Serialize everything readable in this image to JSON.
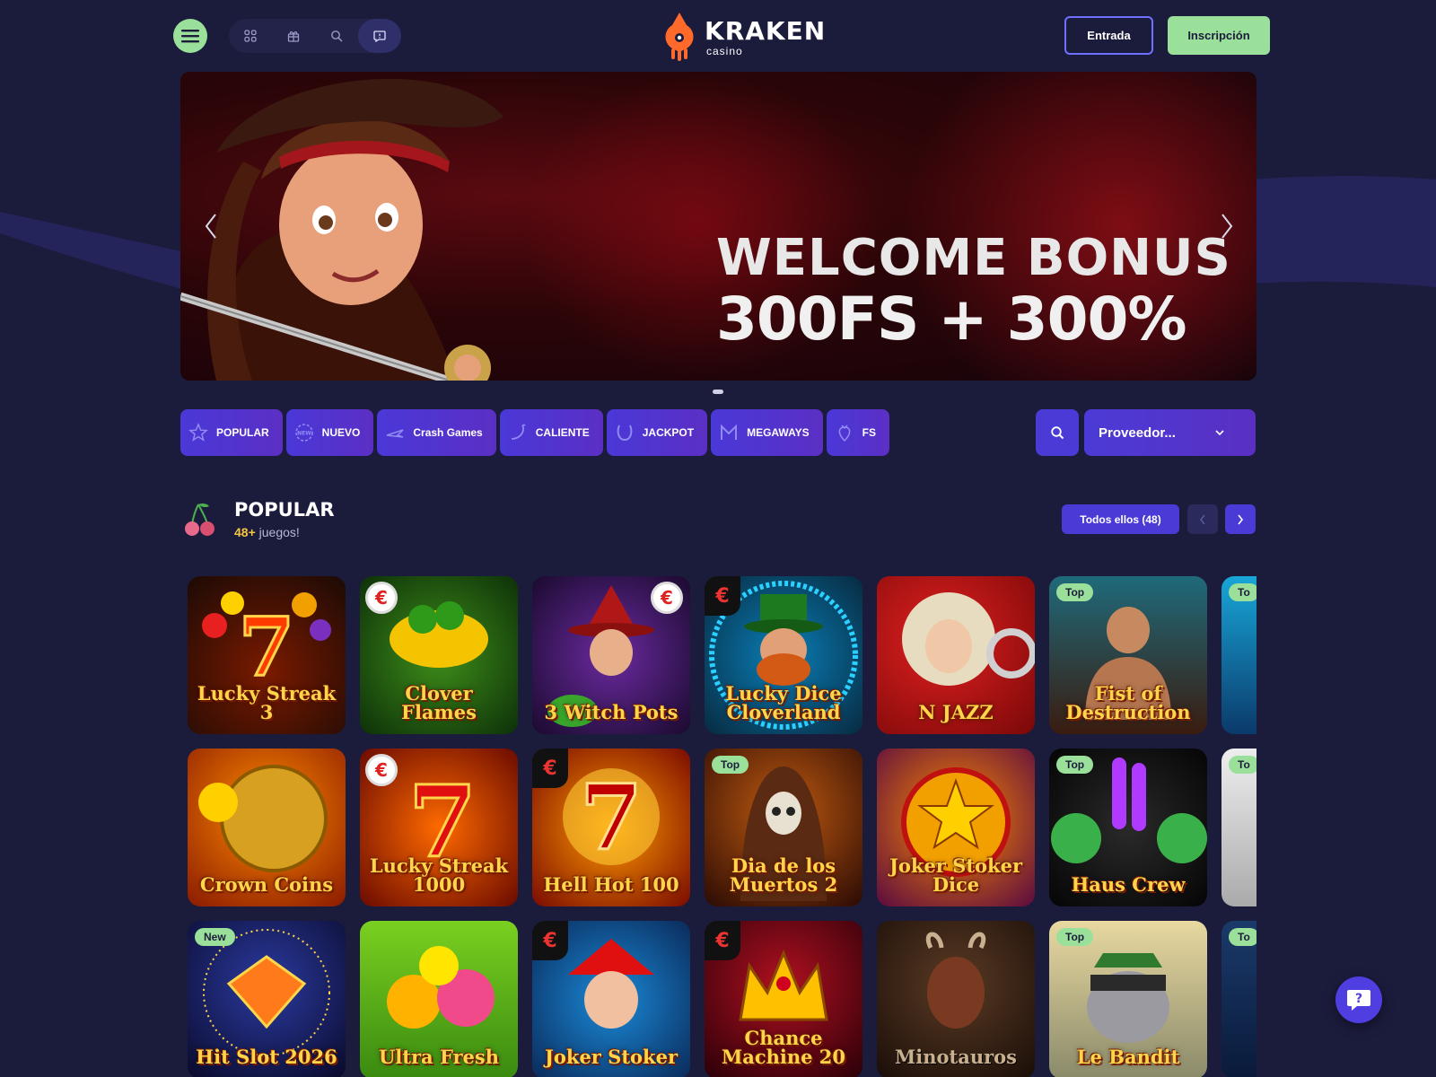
{
  "header": {
    "logo_text": "KRAKEN",
    "logo_sub": "casino",
    "login_label": "Entrada",
    "register_label": "Inscripción"
  },
  "banner": {
    "line1": "WELCOME BONUS",
    "line2": "300FS + 300%"
  },
  "categories": [
    {
      "label": "POPULAR",
      "icon": "star-icon"
    },
    {
      "label": "NUEVO",
      "icon": "new-icon"
    },
    {
      "label": "Crash Games",
      "icon": "plane-icon"
    },
    {
      "label": "CALIENTE",
      "icon": "chili-icon"
    },
    {
      "label": "JACKPOT",
      "icon": "horseshoe-icon"
    },
    {
      "label": "MEGAWAYS",
      "icon": "m-icon"
    },
    {
      "label": "FS",
      "icon": "strawberry-icon"
    }
  ],
  "provider_select": {
    "placeholder": "Proveedor..."
  },
  "section": {
    "title": "POPULAR",
    "count_value": "48+",
    "count_label": " juegos!",
    "all_label": "Todos ellos (48)"
  },
  "games": [
    {
      "name": "Lucky Streak 3",
      "badge": ""
    },
    {
      "name": "Clover Flames",
      "badge": ""
    },
    {
      "name": "3 Witch Pots",
      "badge": ""
    },
    {
      "name": "Lucky Dice Cloverland",
      "badge": ""
    },
    {
      "name": "N JAZZ",
      "badge": ""
    },
    {
      "name": "Fist of Destruction",
      "badge": "Top"
    },
    {
      "name": "",
      "badge": "To"
    },
    {
      "name": "Crown Coins",
      "badge": ""
    },
    {
      "name": "Lucky Streak 1000",
      "badge": ""
    },
    {
      "name": "Hell Hot 100",
      "badge": ""
    },
    {
      "name": "Dia de los Muertos 2",
      "badge": "Top"
    },
    {
      "name": "Joker Stoker Dice",
      "badge": ""
    },
    {
      "name": "Haus Crew",
      "badge": "Top"
    },
    {
      "name": "",
      "badge": "To"
    },
    {
      "name": "Hit Slot 2026",
      "badge": "New"
    },
    {
      "name": "Ultra Fresh",
      "badge": ""
    },
    {
      "name": "Joker Stoker",
      "badge": ""
    },
    {
      "name": "Chance Machine 20",
      "badge": ""
    },
    {
      "name": "Minotauros",
      "badge": ""
    },
    {
      "name": "Le Bandit",
      "badge": "Top"
    },
    {
      "name": "",
      "badge": "To"
    }
  ],
  "colors": {
    "background": "#1b1b3c",
    "accent_green": "#9be09a",
    "accent_purple": "#4b3bd6",
    "count_yellow": "#f5c542"
  }
}
